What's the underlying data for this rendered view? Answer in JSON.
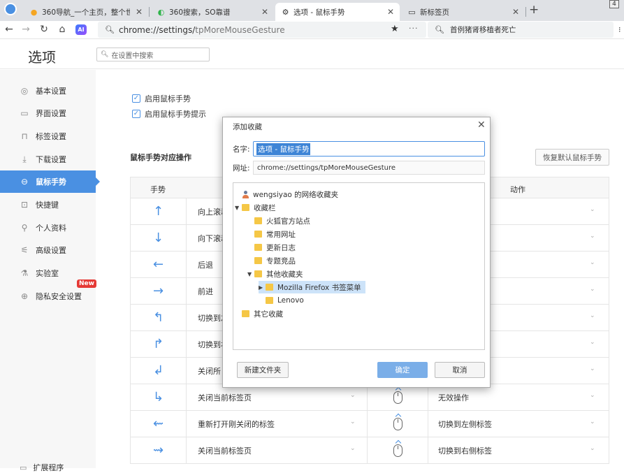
{
  "browser": {
    "tabs": [
      {
        "icon": "360-nav-icon",
        "label": "360导航_一个主页，整个世界",
        "active": false
      },
      {
        "icon": "360-search-icon",
        "label": "360搜索，SO靠谱",
        "active": false
      },
      {
        "icon": "gear-icon",
        "label": "选项 - 鼠标手势",
        "active": true
      },
      {
        "icon": "new-tab-page-icon",
        "label": "新标签页",
        "active": false
      }
    ],
    "window_badge": "4",
    "new_tab": "+",
    "ai_label": "AI",
    "address": {
      "main": "chrome://settings/",
      "rest": "tpMoreMouseGesture"
    },
    "search_hint": "首例猪肾移植者死亡"
  },
  "settings": {
    "title": "选项",
    "search_placeholder": "在设置中搜索"
  },
  "sidebar": {
    "items": [
      {
        "icon": "gear-icon",
        "label": "基本设置"
      },
      {
        "icon": "window-icon",
        "label": "界面设置"
      },
      {
        "icon": "tab-icon",
        "label": "标签设置"
      },
      {
        "icon": "download-icon",
        "label": "下载设置"
      },
      {
        "icon": "mouse-gesture-icon",
        "label": "鼠标手势",
        "active": true
      },
      {
        "icon": "keyboard-icon",
        "label": "快捷键"
      },
      {
        "icon": "user-icon",
        "label": "个人资料"
      },
      {
        "icon": "advanced-icon",
        "label": "高级设置"
      },
      {
        "icon": "lab-icon",
        "label": "实验室"
      },
      {
        "icon": "shield-icon",
        "label": "隐私安全设置",
        "badge": "New"
      }
    ],
    "extension_label": "扩展程序"
  },
  "main": {
    "checkboxes": [
      {
        "label": "启用鼠标手势",
        "checked": true
      },
      {
        "label": "启用鼠标手势提示",
        "checked": true
      }
    ],
    "section_title": "鼠标手势对应操作",
    "restore_button": "恢复默认鼠标手势",
    "table": {
      "headers": {
        "gesture": "手势",
        "action": "动作"
      },
      "rows": [
        {
          "arrow": "↑",
          "gesture_action": "向上滚动",
          "action": ""
        },
        {
          "arrow": "↓",
          "gesture_action": "向下滚动",
          "action": ""
        },
        {
          "arrow": "←",
          "gesture_action": "后退",
          "action": ""
        },
        {
          "arrow": "→",
          "gesture_action": "前进",
          "action": ")"
        },
        {
          "arrow": "↰",
          "gesture_action": "切换到左",
          "action": ""
        },
        {
          "arrow": "↱",
          "gesture_action": "切换到右",
          "action": ""
        },
        {
          "arrow": "↲",
          "gesture_action": "关闭所",
          "action": ""
        },
        {
          "arrow": "↳",
          "gesture_action": "关闭当前标签页",
          "action": "无效操作"
        },
        {
          "arrow": "⇜",
          "gesture_action": "重新打开刚关闭的标签",
          "action": "切换到左侧标签"
        },
        {
          "arrow": "⇝",
          "gesture_action": "关闭当前标签页",
          "action": "切换到右侧标签"
        }
      ]
    }
  },
  "modal": {
    "title": "添加收藏",
    "name_label": "名字:",
    "name_value": "选项 - 鼠标手势",
    "url_label": "网址:",
    "url_value": "chrome://settings/tpMoreMouseGesture",
    "tree": [
      {
        "kind": "user",
        "label": "wengsiyao 的网络收藏夹",
        "expander": ""
      },
      {
        "kind": "folder",
        "label": "收藏栏",
        "expander": "▼"
      },
      {
        "kind": "folder",
        "label": "火狐官方站点",
        "expander": ""
      },
      {
        "kind": "folder",
        "label": "常用网址",
        "expander": ""
      },
      {
        "kind": "folder",
        "label": "更新日志",
        "expander": ""
      },
      {
        "kind": "folder",
        "label": "专题竞品",
        "expander": ""
      },
      {
        "kind": "folder",
        "label": "其他收藏夹",
        "expander": "▼"
      },
      {
        "kind": "folder",
        "label": "Mozilla Firefox 书签菜单",
        "expander": "▶",
        "selected": true
      },
      {
        "kind": "folder",
        "label": "Lenovo",
        "expander": ""
      },
      {
        "kind": "folder",
        "label": "其它收藏",
        "expander": ""
      }
    ],
    "new_folder_button": "新建文件夹",
    "ok_button": "确定",
    "cancel_button": "取消"
  },
  "colors": {
    "accent": "#4a90e2",
    "badge_red": "#e53935",
    "folder": "#f5c746"
  }
}
